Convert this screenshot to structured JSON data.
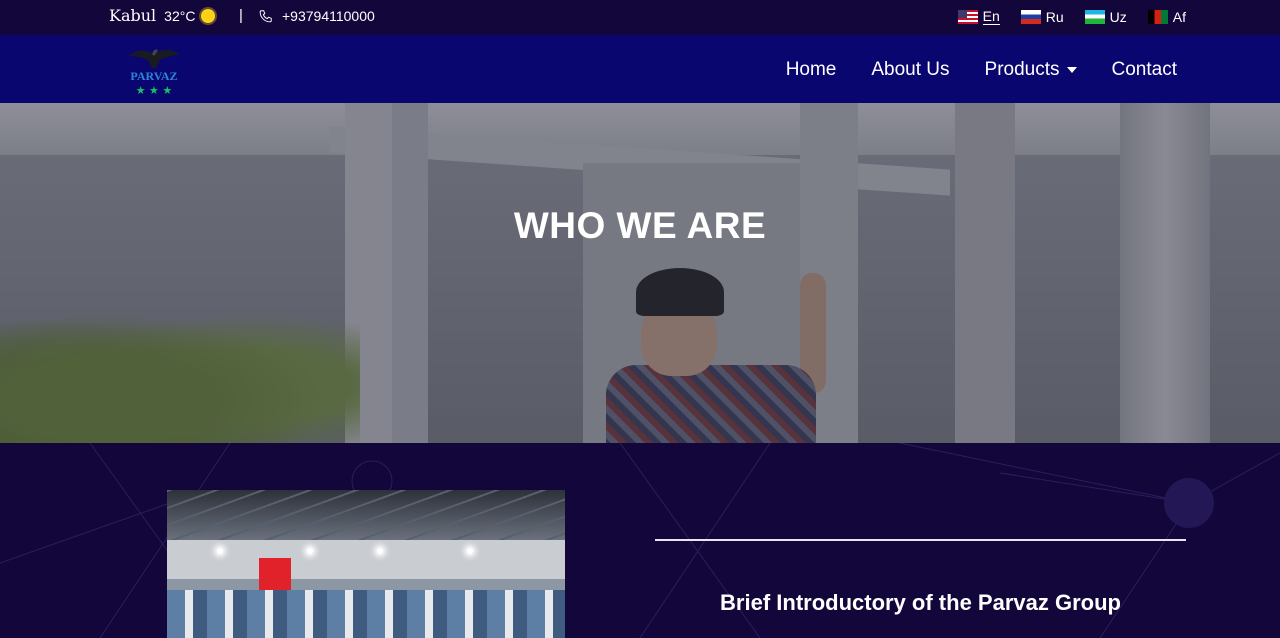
{
  "topbar": {
    "city": "Kabul",
    "temperature": "32°C",
    "weather_icon": "sun-icon",
    "separator": "|",
    "phone": "+93794110000",
    "languages": [
      {
        "code": "En",
        "flag": "us-flag-icon",
        "active": true
      },
      {
        "code": "Ru",
        "flag": "ru-flag-icon",
        "active": false
      },
      {
        "code": "Uz",
        "flag": "uz-flag-icon",
        "active": false
      },
      {
        "code": "Af",
        "flag": "af-flag-icon",
        "active": false
      }
    ]
  },
  "navbar": {
    "logo_text": "PARVAZ",
    "items": [
      {
        "label": "Home"
      },
      {
        "label": "About Us"
      },
      {
        "label": "Products",
        "has_dropdown": true
      },
      {
        "label": "Contact"
      }
    ]
  },
  "hero": {
    "title": "WHO WE ARE"
  },
  "intro": {
    "title": "Brief Introductory of the Parvaz Group"
  },
  "colors": {
    "topbar_bg": "#12063a",
    "navbar_bg": "#0a0670",
    "section_bg": "#12063a"
  }
}
